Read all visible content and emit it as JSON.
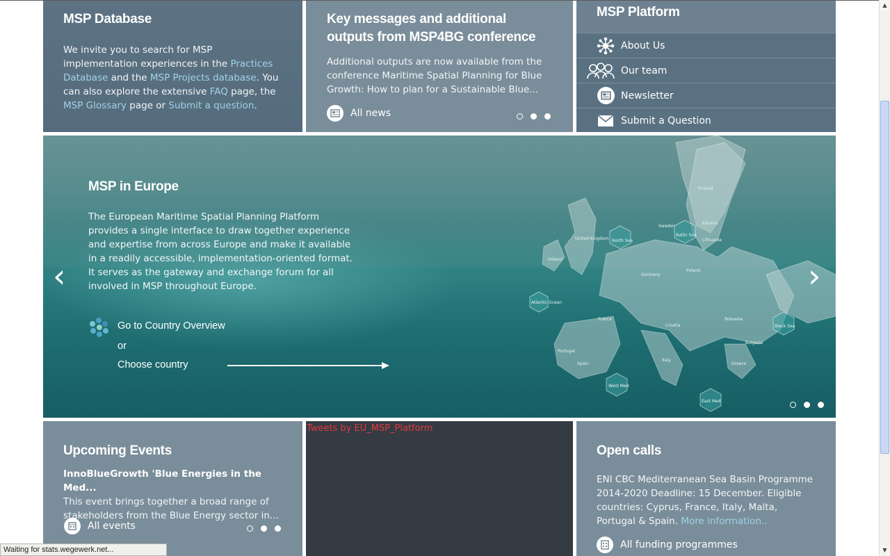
{
  "database_panel": {
    "title": "MSP Database",
    "text_1": "We invite you to search for MSP implementation experiences in the ",
    "link_practices": "Practices Database",
    "text_2": " and the ",
    "link_projects": "MSP Projects database",
    "text_3": ". You can also explore the extensive ",
    "link_faq": "FAQ",
    "text_4": " page, the ",
    "link_glossary": "MSP Glossary",
    "text_5": " page or ",
    "link_submit": "Submit a question",
    "text_6": "."
  },
  "news_panel": {
    "title": "Key messages and additional outputs from MSP4BG conference",
    "text": "Additional outputs are now available from the conference Maritime Spatial Planning for Blue Growth: How to plan for a Sustainable Blue...",
    "all_news": "All news",
    "active_dot": 1
  },
  "platform_panel": {
    "title": "MSP Platform",
    "items": [
      {
        "label": "About Us",
        "icon": "network-icon"
      },
      {
        "label": "Our team",
        "icon": "team-icon"
      },
      {
        "label": "Newsletter",
        "icon": "newsletter-icon"
      },
      {
        "label": "Submit a Question",
        "icon": "envelope-icon"
      }
    ]
  },
  "hero": {
    "title": "MSP in Europe",
    "text": "The European Maritime Spatial Planning Platform provides a single interface to draw together experience and expertise from across Europe and make it available in a readily accessible, implementation-oriented format. It serves as the gateway and exchange forum for all involved in MSP throughout Europe.",
    "country_overview": "Go to Country Overview",
    "or": "or",
    "choose_country": "Choose country",
    "map_labels": [
      "North Sea",
      "Baltic Sea",
      "Atlantic Ocean",
      "Black Sea",
      "West Med",
      "East Med",
      "Finland",
      "Sweden",
      "Estonia",
      "Latvia",
      "Lithuania",
      "Poland",
      "Germany",
      "Ireland",
      "United Kingdom",
      "France",
      "Spain",
      "Portugal",
      "Italy",
      "Croatia",
      "Romania",
      "Bulgaria",
      "Greece"
    ],
    "prev_arrow": "‹",
    "next_arrow": "›",
    "active_dot": 0
  },
  "events_panel": {
    "title": "Upcoming Events",
    "event_title": "InnoBlueGrowth 'Blue Energies in the Med...",
    "event_text": "This event brings together a broad range of stakeholders from the Blue Energy sector in...",
    "all_events": "All events",
    "active_dot": 0
  },
  "tweets_panel": {
    "link": "Tweets by EU_MSP_Platform"
  },
  "calls_panel": {
    "title": "Open calls",
    "text": "ENI CBC Mediterranean Sea Basin Programme 2014-2020 Deadline: 15 December. Eligible countries: Cyprus, France, Italy, Malta, Portugal & Spain. ",
    "more": "More information..",
    "all_funding": "All funding programmes"
  },
  "status_bar": {
    "text": "Waiting for stats.wegewerk.net..."
  },
  "colors": {
    "panel_dark": "#5a7181",
    "panel_light": "#7a8d9a",
    "tweets_bg": "#353b43",
    "link": "#9fd3e6",
    "tweets_link": "#e0393e"
  }
}
